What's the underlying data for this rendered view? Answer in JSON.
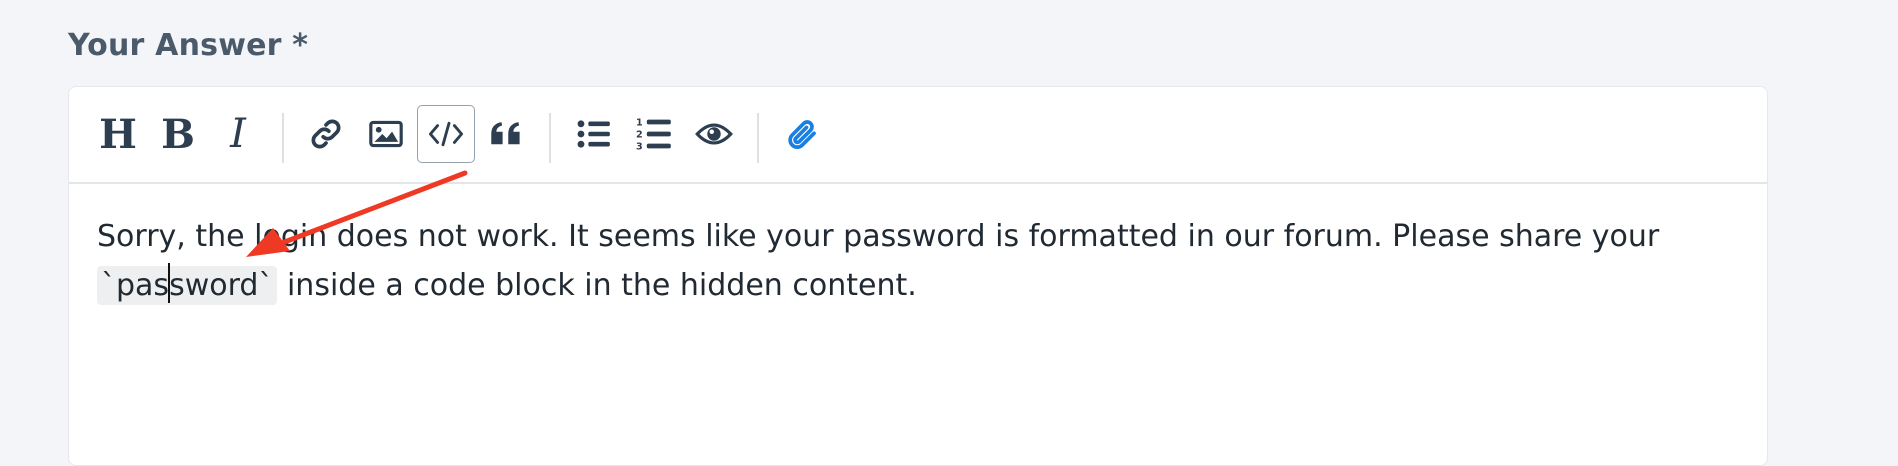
{
  "form": {
    "label": "Your Answer *"
  },
  "toolbar": {
    "buttons": [
      {
        "icon": "heading-icon",
        "label": "H"
      },
      {
        "icon": "bold-icon",
        "label": "B"
      },
      {
        "icon": "italic-icon",
        "label": "I"
      },
      {
        "icon": "link-icon"
      },
      {
        "icon": "image-icon"
      },
      {
        "icon": "code-icon",
        "active": true
      },
      {
        "icon": "quote-icon"
      },
      {
        "icon": "bulleted-list-icon"
      },
      {
        "icon": "numbered-list-icon"
      },
      {
        "icon": "preview-eye-icon"
      },
      {
        "icon": "attachment-icon"
      }
    ],
    "attachment_color": "#1a7fe0"
  },
  "editor": {
    "line1": "Sorry, the login does not work. It seems like your password is formatted in our forum. Please share your",
    "code_before_caret": "`pas",
    "code_after_caret": "sword`",
    "line2_rest": " inside a code block in the hidden content."
  },
  "annotation": {
    "arrow_color": "#ee3a24"
  }
}
